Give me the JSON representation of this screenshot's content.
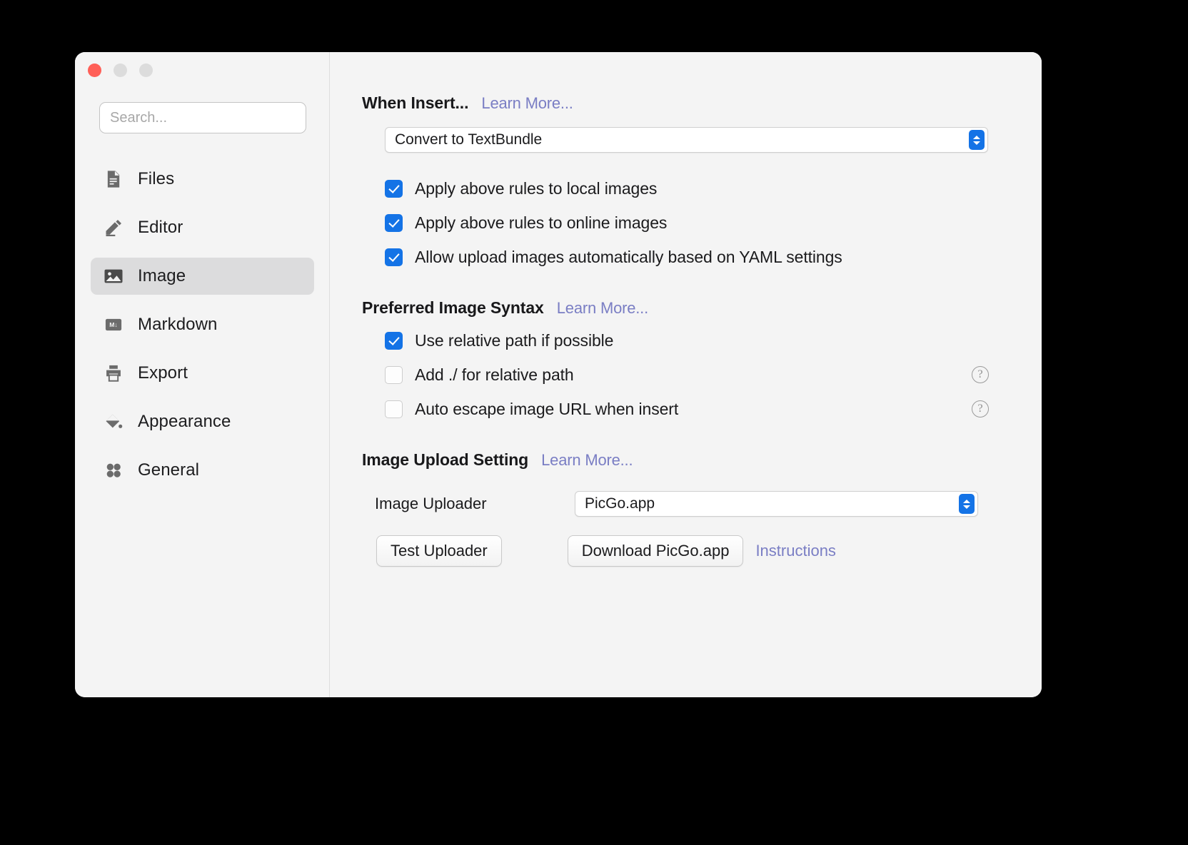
{
  "window": {
    "traffic_lights": [
      "close",
      "minimize",
      "maximize"
    ]
  },
  "sidebar": {
    "search": {
      "placeholder": "Search...",
      "value": ""
    },
    "items": [
      {
        "label": "Files",
        "icon": "document-icon",
        "active": false
      },
      {
        "label": "Editor",
        "icon": "pencil-icon",
        "active": false
      },
      {
        "label": "Image",
        "icon": "image-icon",
        "active": true
      },
      {
        "label": "Markdown",
        "icon": "markdown-icon",
        "active": false
      },
      {
        "label": "Export",
        "icon": "printer-icon",
        "active": false
      },
      {
        "label": "Appearance",
        "icon": "paint-bucket-icon",
        "active": false
      },
      {
        "label": "General",
        "icon": "grid-dots-icon",
        "active": false
      }
    ]
  },
  "content": {
    "when_insert": {
      "title": "When Insert...",
      "learn_more": "Learn More...",
      "select_value": "Convert to TextBundle",
      "checkboxes": [
        {
          "label": "Apply above rules to local images",
          "checked": true,
          "help": false
        },
        {
          "label": "Apply above rules to online images",
          "checked": true,
          "help": false
        },
        {
          "label": "Allow upload images automatically based on YAML settings",
          "checked": true,
          "help": false
        }
      ]
    },
    "preferred_syntax": {
      "title": "Preferred Image Syntax",
      "learn_more": "Learn More...",
      "checkboxes": [
        {
          "label": "Use relative path if possible",
          "checked": true,
          "help": false
        },
        {
          "label": "Add ./ for relative path",
          "checked": false,
          "help": true
        },
        {
          "label": "Auto escape image URL when insert",
          "checked": false,
          "help": true
        }
      ]
    },
    "image_upload": {
      "title": "Image Upload Setting",
      "learn_more": "Learn More...",
      "uploader_label": "Image Uploader",
      "uploader_value": "PicGo.app",
      "test_button": "Test Uploader",
      "download_button": "Download PicGo.app",
      "instructions_link": "Instructions"
    }
  },
  "colors": {
    "accent": "#1473e6",
    "link": "#7a7ec4",
    "window_bg": "#f4f4f4",
    "selected_row": "#dcdcdd",
    "close_red": "#ff5f57"
  },
  "help_glyph": "?"
}
